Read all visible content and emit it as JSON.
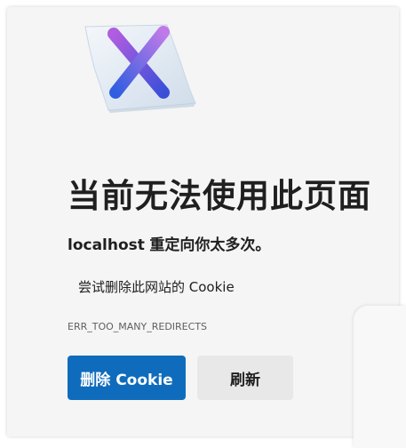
{
  "error": {
    "title": "当前无法使用此页面",
    "host": "localhost",
    "message": "重定向你太多次。",
    "suggestion": "尝试删除此网站的 Cookie",
    "code": "ERR_TOO_MANY_REDIRECTS"
  },
  "buttons": {
    "delete_cookie": "删除 Cookie",
    "refresh": "刷新"
  },
  "icons": {
    "illustration": "error-x-document-icon"
  },
  "colors": {
    "primary": "#0f6cbd",
    "secondary": "#e8e8e8",
    "background": "#f5f5f5"
  }
}
